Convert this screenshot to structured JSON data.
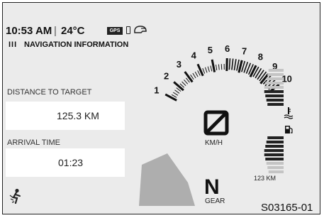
{
  "status": {
    "time": "10:53 AM",
    "separator": "|",
    "temperature": "24°C",
    "gps_badge": "GPS"
  },
  "menu_icon": "III",
  "navigation_title": "NAVIGATION INFORMATION",
  "distance": {
    "label": "DISTANCE TO TARGET",
    "value": "125.3 KM"
  },
  "arrival": {
    "label": "ARRIVAL TIME",
    "value": "01:23"
  },
  "tach_labels": [
    "1",
    "2",
    "3",
    "4",
    "5",
    "6",
    "7",
    "8",
    "9",
    "10"
  ],
  "speed": {
    "unit": "KM/H"
  },
  "gear": {
    "value": "N",
    "label": "GEAR"
  },
  "fuel_range": "123 KM",
  "reference_code": "S03165-01",
  "colors": {
    "panel_bg": "#ebebeb",
    "value_bg": "#ffffff",
    "tick": "#111111",
    "rpm_zone": "#9a9a9a"
  },
  "icons": [
    "gps-icon",
    "phone-icon",
    "helmet-icon",
    "menu-icon",
    "coolant-temperature-icon",
    "fuel-pump-icon",
    "rider-icon",
    "speed-placeholder-icon"
  ]
}
